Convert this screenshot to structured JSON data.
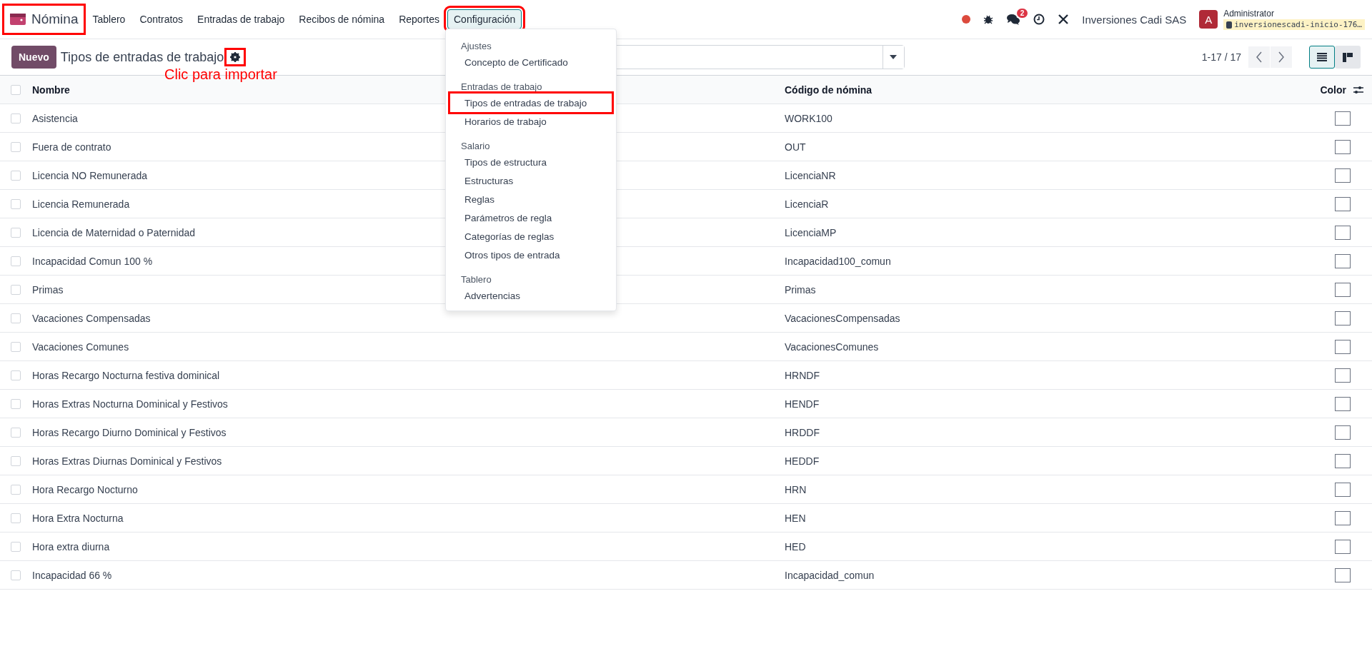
{
  "navbar": {
    "app": {
      "name": "Nómina",
      "highlighted": true
    },
    "menu": [
      {
        "label": "Tablero",
        "selected": false,
        "highlighted": false
      },
      {
        "label": "Contratos",
        "selected": false,
        "highlighted": false
      },
      {
        "label": "Entradas de trabajo",
        "selected": false,
        "highlighted": false
      },
      {
        "label": "Recibos de nómina",
        "selected": false,
        "highlighted": false
      },
      {
        "label": "Reportes",
        "selected": false,
        "highlighted": false
      },
      {
        "label": "Configuración",
        "selected": true,
        "highlighted": true
      }
    ],
    "messages_badge": "2",
    "company": "Inversiones Cadi SAS",
    "avatar": "A",
    "user": "Administrator",
    "database": "inversionescadi-inicio-176…"
  },
  "dropdown": {
    "sections": [
      {
        "title": "Ajustes",
        "items": [
          {
            "label": "Concepto de Certificado",
            "highlighted": false
          }
        ]
      },
      {
        "title": "Entradas de trabajo",
        "items": [
          {
            "label": "Tipos de entradas de trabajo",
            "highlighted": true
          },
          {
            "label": "Horarios de trabajo",
            "highlighted": false
          }
        ]
      },
      {
        "title": "Salario",
        "items": [
          {
            "label": "Tipos de estructura",
            "highlighted": false
          },
          {
            "label": "Estructuras",
            "highlighted": false
          },
          {
            "label": "Reglas",
            "highlighted": false
          },
          {
            "label": "Parámetros de regla",
            "highlighted": false
          },
          {
            "label": "Categorías de reglas",
            "highlighted": false
          },
          {
            "label": "Otros tipos de entrada",
            "highlighted": false
          }
        ]
      },
      {
        "title": "Tablero",
        "items": [
          {
            "label": "Advertencias",
            "highlighted": false
          }
        ]
      }
    ]
  },
  "control_panel": {
    "new_button": "Nuevo",
    "title": "Tipos de entradas de trabajo",
    "gear_highlighted": true,
    "annotation": "Clic para importar",
    "pager": "1-17 / 17",
    "views": [
      {
        "kind": "list",
        "selected": true
      },
      {
        "kind": "kanban",
        "selected": false
      }
    ]
  },
  "table": {
    "columns": [
      "Nombre",
      "Código de nómina",
      "Color"
    ],
    "all_selected": false,
    "rows": [
      {
        "name": "Asistencia",
        "code": "WORK100",
        "selected": false
      },
      {
        "name": "Fuera de contrato",
        "code": "OUT",
        "selected": false
      },
      {
        "name": "Licencia NO Remunerada",
        "code": "LicenciaNR",
        "selected": false
      },
      {
        "name": "Licencia Remunerada",
        "code": "LicenciaR",
        "selected": false
      },
      {
        "name": "Licencia de Maternidad o Paternidad",
        "code": "LicenciaMP",
        "selected": false
      },
      {
        "name": "Incapacidad Comun 100 %",
        "code": "Incapacidad100_comun",
        "selected": false
      },
      {
        "name": "Primas",
        "code": "Primas",
        "selected": false
      },
      {
        "name": "Vacaciones Compensadas",
        "code": "VacacionesCompensadas",
        "selected": false
      },
      {
        "name": "Vacaciones Comunes",
        "code": "VacacionesComunes",
        "selected": false
      },
      {
        "name": "Horas Recargo Nocturna festiva dominical",
        "code": "HRNDF",
        "selected": false
      },
      {
        "name": "Horas Extras Nocturna Dominical y Festivos",
        "code": "HENDF",
        "selected": false
      },
      {
        "name": "Horas Recargo Diurno Dominical y Festivos",
        "code": "HRDDF",
        "selected": false
      },
      {
        "name": "Horas Extras Diurnas Dominical y Festivos",
        "code": "HEDDF",
        "selected": false
      },
      {
        "name": "Hora Recargo Nocturno",
        "code": "HRN",
        "selected": false
      },
      {
        "name": "Hora Extra Nocturna",
        "code": "HEN",
        "selected": false
      },
      {
        "name": "Hora extra diurna",
        "code": "HED",
        "selected": false
      },
      {
        "name": "Incapacidad 66 %",
        "code": "Incapacidad_comun",
        "selected": false
      }
    ]
  }
}
